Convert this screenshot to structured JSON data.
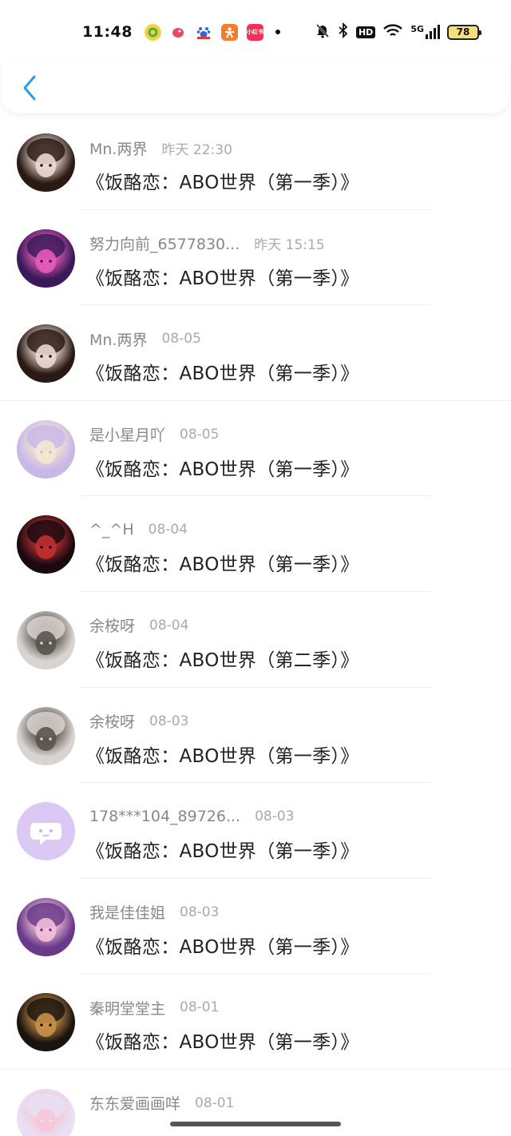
{
  "status_bar": {
    "time": "11:48",
    "app_icons": [
      {
        "name": "green-circle-app-icon",
        "color": "#f0d030"
      },
      {
        "name": "red-bird-app-icon",
        "color": "#e84a5f"
      },
      {
        "name": "baidu-app-icon",
        "color": "#3066d6"
      },
      {
        "name": "orange-person-app-icon",
        "color": "#f57c2c"
      },
      {
        "name": "xiaohongshu-app-icon",
        "color": "#ff2d55",
        "label": "小红书"
      }
    ],
    "hd_label": "HD",
    "network_label": "5G",
    "battery_level": "78"
  },
  "header": {
    "back_icon": "chevron-left-icon",
    "accent_color": "#2e9be8"
  },
  "items": [
    {
      "user": "Mn.两界",
      "time": "昨天 22:30",
      "title": "《饭酪恋：ABO世界（第一季）》",
      "avatar_style": "dark-hair-boy",
      "colors": [
        "#2a1a14",
        "#e8d8d0"
      ]
    },
    {
      "user": "努力向前_6577830...",
      "time": "昨天 15:15",
      "title": "《饭酪恋：ABO世界（第一季）》",
      "avatar_style": "pink-anime",
      "colors": [
        "#3a1a5a",
        "#e85ab8"
      ]
    },
    {
      "user": "Mn.两界",
      "time": "08-05",
      "title": "《饭酪恋：ABO世界（第一季）》",
      "avatar_style": "dark-hair-boy",
      "colors": [
        "#2a1a14",
        "#e8d8d0"
      ]
    },
    {
      "user": "是小星月吖",
      "time": "08-05",
      "title": "《饭酪恋：ABO世界（第一季）》",
      "avatar_style": "lantern-girl",
      "colors": [
        "#c8b8e8",
        "#f5e8d0"
      ]
    },
    {
      "user": "^_^H",
      "time": "08-04",
      "title": "《饭酪恋：ABO世界（第一季）》",
      "avatar_style": "night-photo",
      "colors": [
        "#1a0a10",
        "#c03030"
      ]
    },
    {
      "user": "余桉呀",
      "time": "08-04",
      "title": "《饭酪恋：ABO世界（第二季）》",
      "avatar_style": "gray-anime",
      "colors": [
        "#d8d4d0",
        "#5a5450"
      ]
    },
    {
      "user": "余桉呀",
      "time": "08-03",
      "title": "《饭酪恋：ABO世界（第一季）》",
      "avatar_style": "gray-anime",
      "colors": [
        "#d8d4d0",
        "#5a5450"
      ]
    },
    {
      "user": "178***104_89726...",
      "time": "08-03",
      "title": "《饭酪恋：ABO世界（第一季）》",
      "avatar_style": "default-chat",
      "colors": [
        "#dcc8f5",
        "#ffffff"
      ]
    },
    {
      "user": "我是佳佳姐",
      "time": "08-03",
      "title": "《饭酪恋：ABO世界（第一季）》",
      "avatar_style": "princess",
      "colors": [
        "#6a3a8a",
        "#f2c0d8"
      ]
    },
    {
      "user": "秦明堂堂主",
      "time": "08-01",
      "title": "《饭酪恋：ABO世界（第一季）》",
      "avatar_style": "dark-warrior",
      "colors": [
        "#1a140e",
        "#c89048"
      ]
    },
    {
      "user": "东东爱画画咩",
      "time": "08-01",
      "title": "",
      "avatar_style": "pastel-anime",
      "colors": [
        "#e8e0f5",
        "#f5c8d8"
      ]
    }
  ]
}
